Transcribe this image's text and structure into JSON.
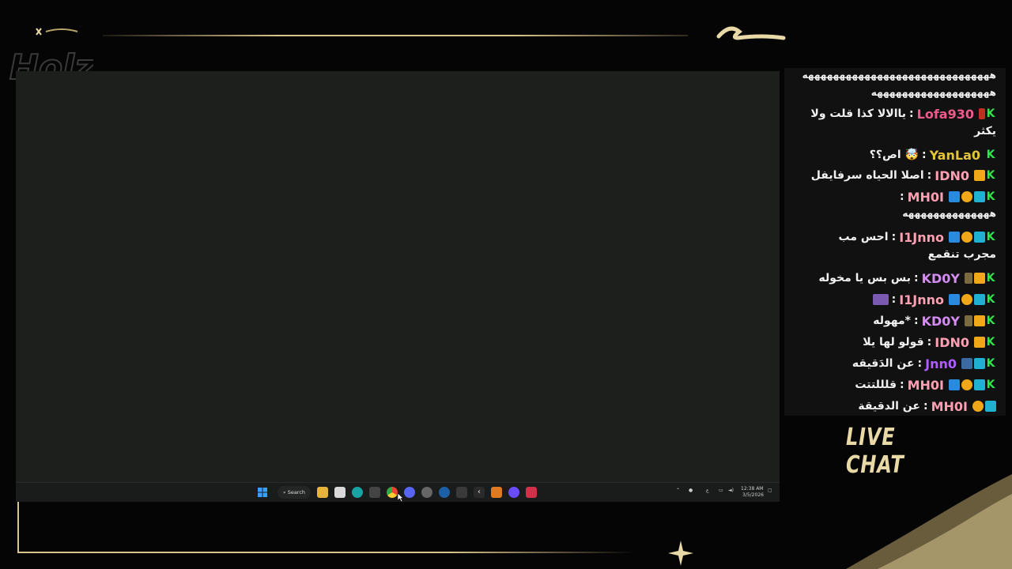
{
  "overlay": {
    "logo_text": "Holz",
    "live_chat_label": "LIVE CHAT"
  },
  "taskbar": {
    "search_label": "Search",
    "clock_time": "12:38 AM",
    "clock_date": "3/5/2026",
    "apps": [
      "windows-start",
      "file-explorer",
      "microsoft-store",
      "edge",
      "widget",
      "chrome",
      "discord",
      "app-settings",
      "steam",
      "keyboard",
      "kick",
      "app-a",
      "discord-2",
      "app-red"
    ]
  },
  "chat": {
    "messages": [
      {
        "user": "",
        "text": "ههههههههههههههههههههههههههههههه",
        "user_color": "#ffffff"
      },
      {
        "user": "",
        "text": "هههههههههههههههههههه",
        "user_color": "#ffffff"
      },
      {
        "user": "Lofa930",
        "text": "ياالالا كذا قلت ولا",
        "user_color": "#f05a8a",
        "wrap": "يكثر"
      },
      {
        "user": "YanLa0",
        "text": "اص؟؟ 🤯",
        "user_color": "#e2c43a"
      },
      {
        "user": "IDN0",
        "text": "اصلا الحياه سرفايفل",
        "user_color": "#ff9fb2"
      },
      {
        "user": "MH0I",
        "text": "",
        "user_color": "#ff9fb2",
        "wrap": "ههههههههههههههه"
      },
      {
        "user": "I1Jnno",
        "text": "احس مب",
        "user_color": "#ff9fb2",
        "wrap": "مجرب تنقمع"
      },
      {
        "user": "KD0Y",
        "text": "بس بس يا مخوله",
        "user_color": "#d38cf0"
      },
      {
        "user": "I1Jnno",
        "text": "",
        "user_color": "#ff9fb2"
      },
      {
        "user": "KD0Y",
        "text": "مهوله*",
        "user_color": "#d38cf0"
      },
      {
        "user": "IDN0",
        "text": "قولو لها يلا",
        "user_color": "#ff9fb2"
      },
      {
        "user": "Jnn0",
        "text": "عن الدَقيقه",
        "user_color": "#b05cff"
      },
      {
        "user": "MH0I",
        "text": "قلللتتت",
        "user_color": "#ff9fb2"
      },
      {
        "user": "MH0I",
        "text": "عن الدقيقة",
        "user_color": "#ff9fb2"
      }
    ]
  },
  "colors": {
    "gold": "#d9c48a",
    "kick_green": "#30e64a"
  }
}
